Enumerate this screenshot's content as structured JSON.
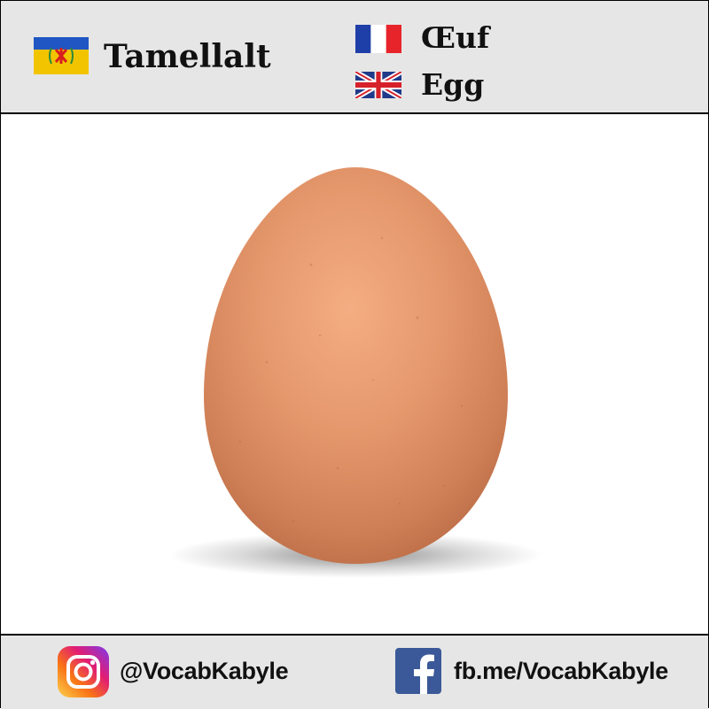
{
  "header": {
    "kabyle_word": "Tamellalt",
    "french_word": "Œuf",
    "english_word": "Egg",
    "kabyle_flag_icon": "kabyle-flag-icon",
    "french_flag_icon": "french-flag-icon",
    "uk_flag_icon": "uk-flag-icon"
  },
  "main": {
    "image_icon": "egg-illustration",
    "egg_color": "#d9865d",
    "background_color": "#ffffff"
  },
  "footer": {
    "instagram_icon": "instagram-icon",
    "instagram_handle": "@VocabKabyle",
    "facebook_icon": "facebook-icon",
    "facebook_link": "fb.me/VocabKabyle"
  },
  "colors": {
    "bar_background": "#e6e6e6",
    "border": "#000000",
    "text": "#111111",
    "facebook_blue": "#3b5998"
  }
}
